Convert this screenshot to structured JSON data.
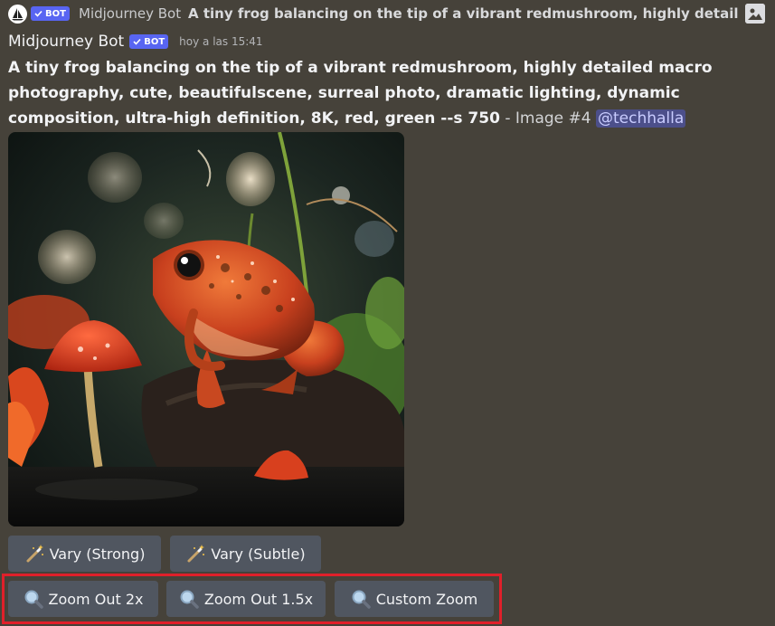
{
  "reply": {
    "bot_tag": "BOT",
    "author": "Midjourney Bot",
    "text": "A tiny frog balancing on the tip of a vibrant redmushroom, highly detailed macro"
  },
  "message": {
    "author": "Midjourney Bot",
    "bot_tag": "BOT",
    "timestamp": "hoy a las 15:41",
    "prompt_bold": "A tiny frog balancing on the tip of a vibrant redmushroom, highly detailed macro photography, cute, beautifulscene, surreal photo, dramatic lighting, dynamic composition, ultra-high definition, 8K, red, green --s 750",
    "suffix": " - Image #4 ",
    "mention": "@techhalla"
  },
  "buttons": {
    "vary_strong": "Vary (Strong)",
    "vary_subtle": "Vary (Subtle)",
    "zoom_out_2x": "Zoom Out 2x",
    "zoom_out_15x": "Zoom Out 1.5x",
    "custom_zoom": "Custom Zoom"
  },
  "colors": {
    "background": "#46423a",
    "bot_tag": "#5865f2",
    "button": "#505660",
    "highlight": "#e0202a",
    "mention_bg": "#4c4f8a"
  },
  "icons": {
    "vary": "magic-wand-icon",
    "zoom": "magnifier-icon",
    "reply_image": "image-icon"
  }
}
